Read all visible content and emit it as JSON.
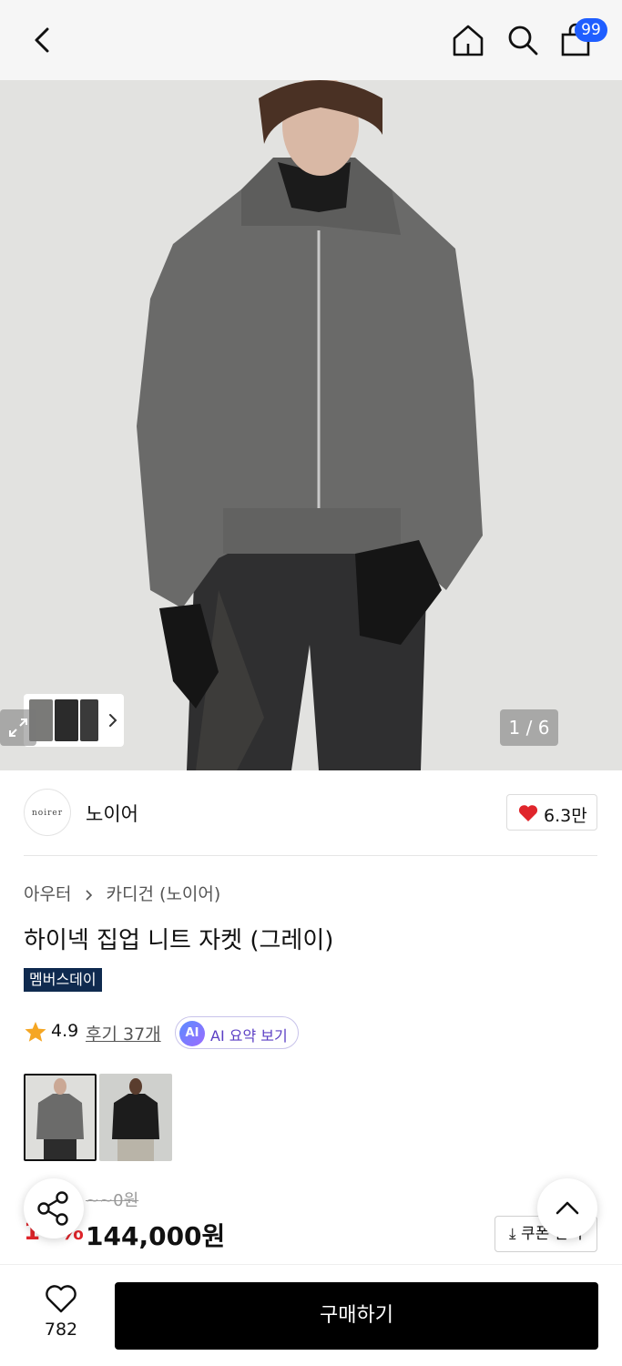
{
  "header": {
    "cart_badge": "99",
    "icons": [
      "back-arrow-icon",
      "home-icon",
      "search-icon",
      "shopping-bag-icon"
    ]
  },
  "gallery": {
    "pager": "1 / 6"
  },
  "brand": {
    "logo_text": "noirer",
    "name": "노이어",
    "likes": "6.3만"
  },
  "breadcrumb": {
    "level1": "아우터",
    "level2": "카디건 (노이어)"
  },
  "product": {
    "title": "하이넥 집업 니트 자켓 (그레이)",
    "tag": "멤버스데이",
    "rating": "4.9",
    "reviews": "후기 37개",
    "ai_badge": "AI",
    "ai_summary": "AI 요약 보기",
    "original_price": "~~0원",
    "discount": "1~%",
    "price": "144,000원",
    "coupon": "쿠폰 받기"
  },
  "colors": {
    "accent_red": "#e0252b",
    "badge_blue": "#1f5eff",
    "tag_navy": "#0f2a4f",
    "buy_bg": "#000000"
  },
  "bottom": {
    "wish_count": "782",
    "buy_label": "구매하기"
  }
}
